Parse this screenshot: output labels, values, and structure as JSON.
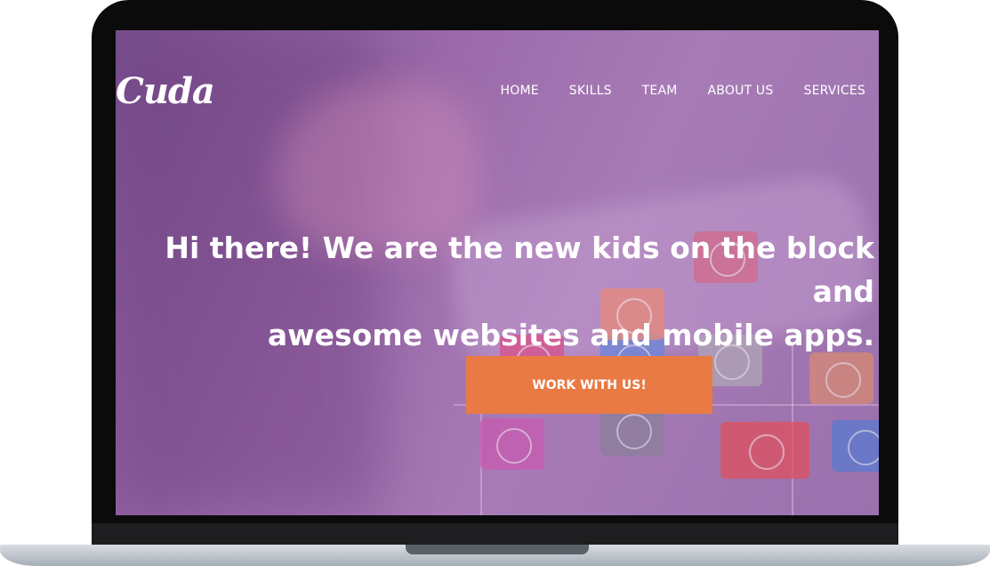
{
  "site": {
    "logo": "Cuda"
  },
  "nav": {
    "items": [
      {
        "label": "HOME"
      },
      {
        "label": "SKILLS"
      },
      {
        "label": "TEAM"
      },
      {
        "label": "ABOUT US"
      },
      {
        "label": "SERVICES"
      }
    ]
  },
  "hero": {
    "headline_line1": "Hi there! We are the new kids on the block and",
    "headline_line2": "awesome websites and mobile apps.",
    "cta_label": "WORK WITH US!"
  },
  "colors": {
    "accent": "#e97a44",
    "overlay": "#9b6aa9"
  }
}
